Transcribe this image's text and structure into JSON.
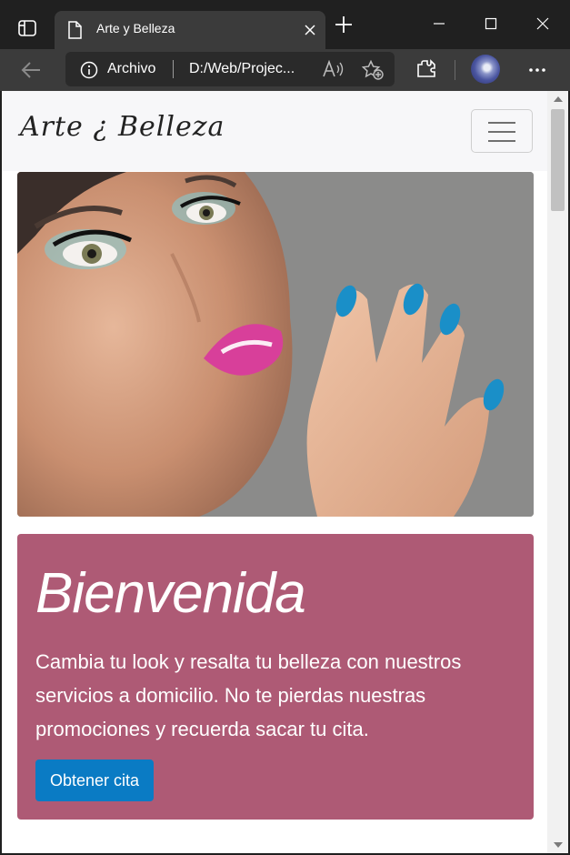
{
  "browser": {
    "tab_title": "Arte y Belleza",
    "address_scheme": "Archivo",
    "address_url": "D:/Web/Projec...",
    "icons": [
      "tab-actions-icon",
      "page-icon",
      "close-icon",
      "plus-icon",
      "minimize-icon",
      "maximize-icon",
      "window-close-icon",
      "back-arrow-icon",
      "info-icon",
      "read-aloud-icon",
      "favorite-add-icon",
      "extensions-icon",
      "profile-avatar",
      "more-icon"
    ]
  },
  "site": {
    "brand": "Arte ¿ Belleza",
    "menu_icon": "hamburger-icon"
  },
  "jumbotron": {
    "title": "Bienvenida",
    "text": "Cambia tu look y resalta tu belleza con nuestros servicios a domicilio. No te pierdas nuestras promociones y recuerda sacar tu cita.",
    "button": "Obtener cita",
    "bg_color": "#ae5a75",
    "button_color": "#0a7bc4"
  }
}
